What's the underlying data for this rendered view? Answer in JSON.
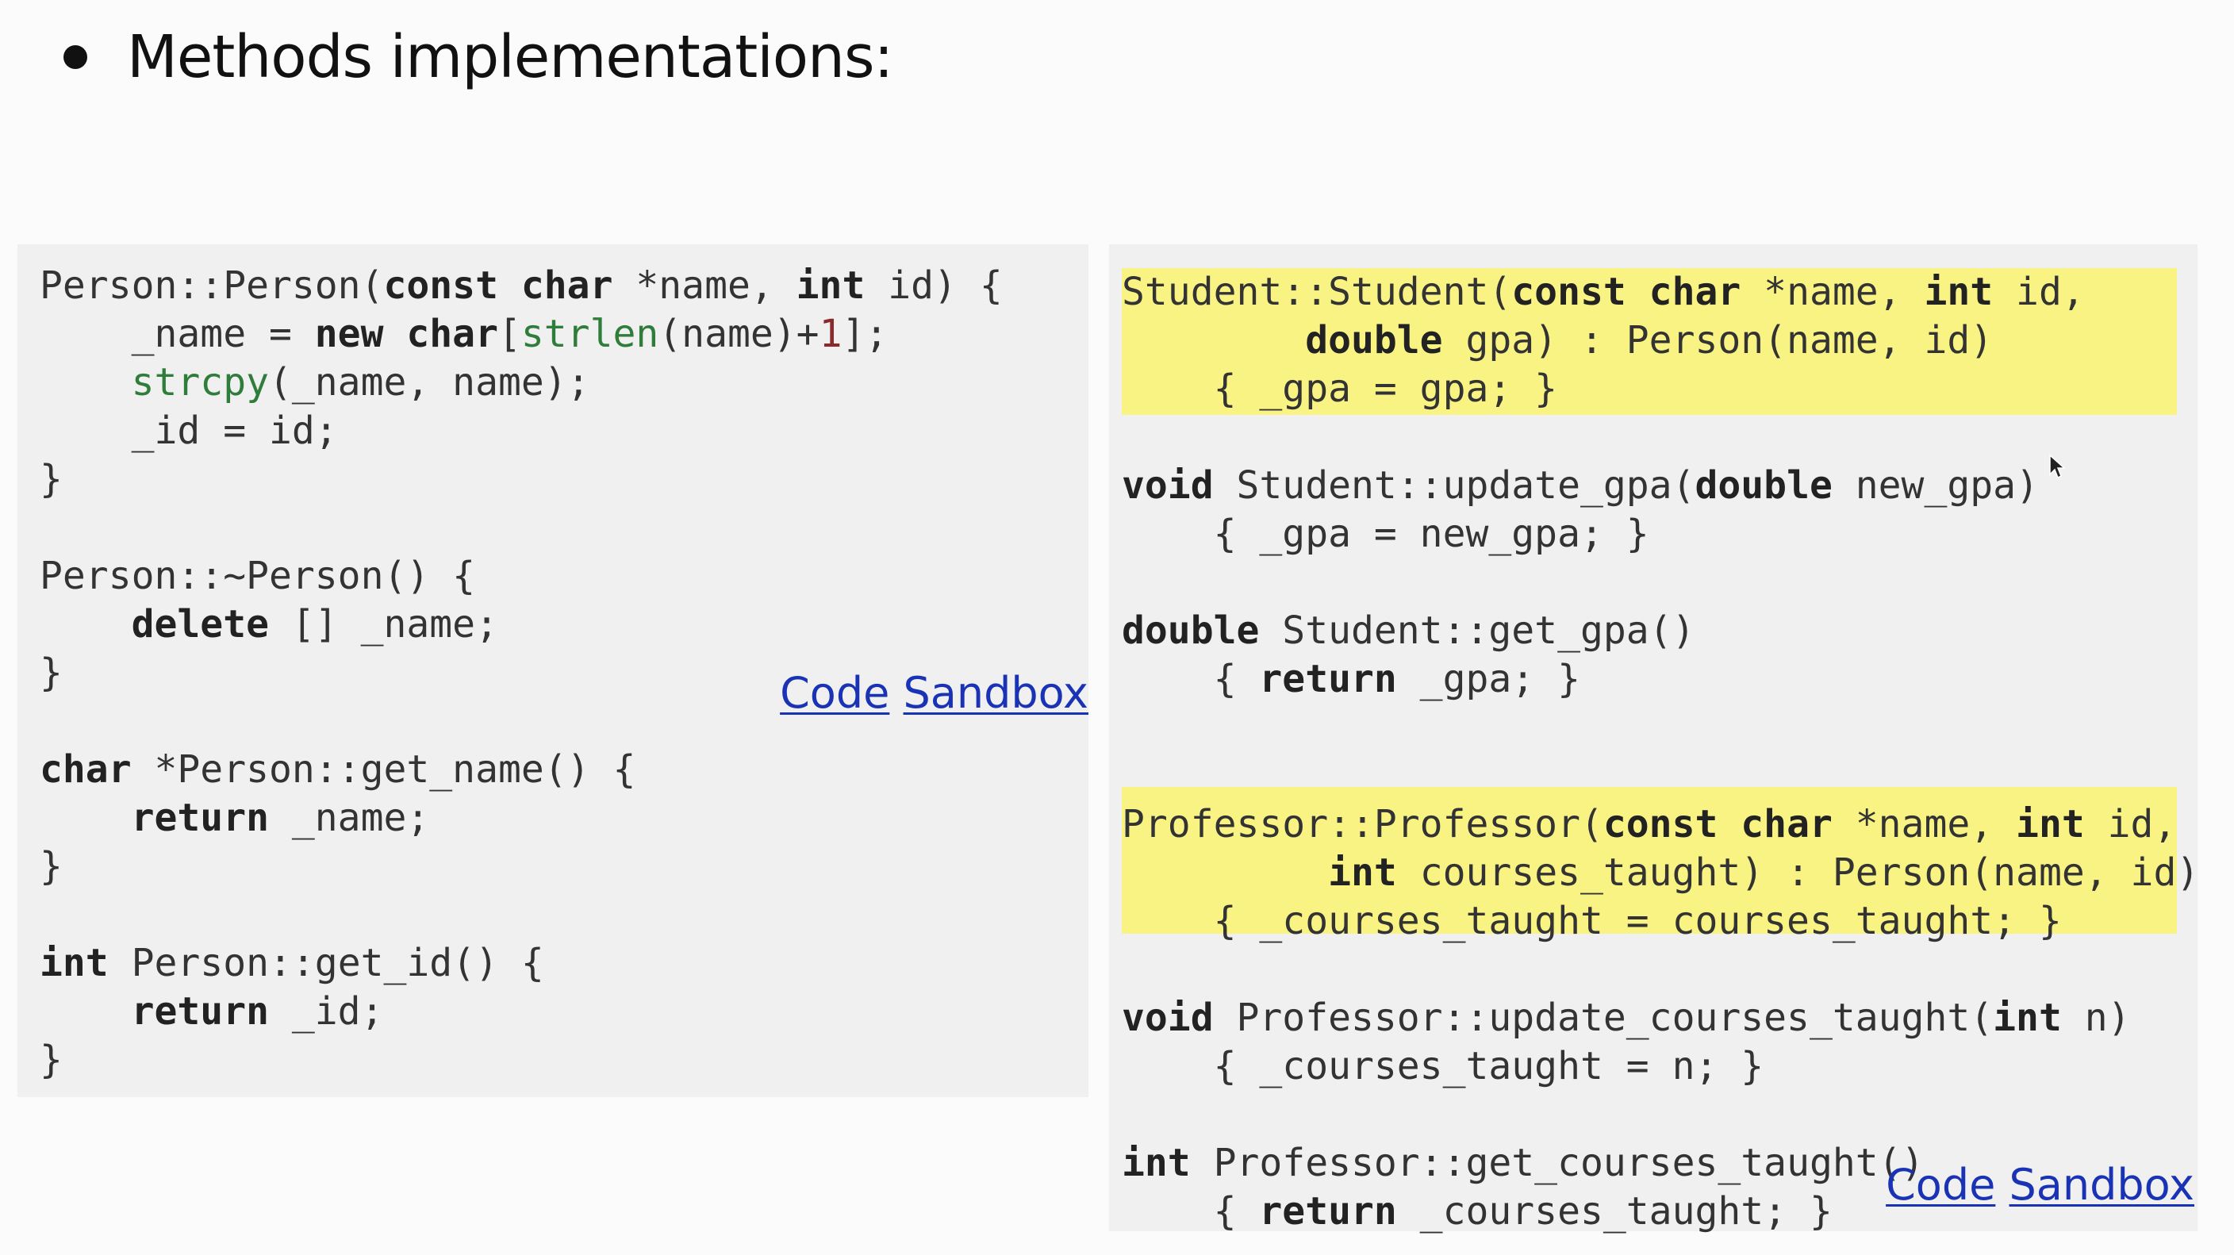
{
  "title": "Methods implementations:",
  "left_panel": {
    "code": [
      [
        {
          "t": "Person::Person("
        },
        {
          "t": "const char",
          "k": "kw"
        },
        {
          "t": " *name, "
        },
        {
          "t": "int",
          "k": "kw"
        },
        {
          "t": " id) {"
        }
      ],
      [
        {
          "t": "    _name = "
        },
        {
          "t": "new char",
          "k": "kw"
        },
        {
          "t": "["
        },
        {
          "t": "strlen",
          "k": "fn"
        },
        {
          "t": "(name)+"
        },
        {
          "t": "1",
          "k": "num"
        },
        {
          "t": "];"
        }
      ],
      [
        {
          "t": "    "
        },
        {
          "t": "strcpy",
          "k": "fn"
        },
        {
          "t": "(_name, name);"
        }
      ],
      [
        {
          "t": "    _id = id;"
        }
      ],
      [
        {
          "t": "}"
        }
      ],
      [
        {
          "t": ""
        }
      ],
      [
        {
          "t": "Person::~Person() {"
        }
      ],
      [
        {
          "t": "    "
        },
        {
          "t": "delete",
          "k": "kw"
        },
        {
          "t": " [] _name;"
        }
      ],
      [
        {
          "t": "}"
        }
      ],
      [
        {
          "t": ""
        }
      ],
      [
        {
          "t": "char",
          "k": "kw"
        },
        {
          "t": " *Person::get_name() {"
        }
      ],
      [
        {
          "t": "    "
        },
        {
          "t": "return",
          "k": "kw"
        },
        {
          "t": " _name;"
        }
      ],
      [
        {
          "t": "}"
        }
      ],
      [
        {
          "t": ""
        }
      ],
      [
        {
          "t": "int",
          "k": "kw"
        },
        {
          "t": " Person::get_id() {"
        }
      ],
      [
        {
          "t": "    "
        },
        {
          "t": "return",
          "k": "kw"
        },
        {
          "t": " _id;"
        }
      ],
      [
        {
          "t": "}"
        }
      ]
    ],
    "link_code": "Code",
    "link_sandbox": "Sandbox"
  },
  "right_panel": {
    "code": [
      [
        {
          "t": "Student::Student("
        },
        {
          "t": "const char",
          "k": "kw"
        },
        {
          "t": " *name, "
        },
        {
          "t": "int",
          "k": "kw"
        },
        {
          "t": " id,"
        }
      ],
      [
        {
          "t": "        "
        },
        {
          "t": "double",
          "k": "kw"
        },
        {
          "t": " gpa) : Person(name, id)"
        }
      ],
      [
        {
          "t": "    { _gpa = gpa; }"
        }
      ],
      [
        {
          "t": ""
        }
      ],
      [
        {
          "t": "void",
          "k": "kw"
        },
        {
          "t": " Student::update_gpa("
        },
        {
          "t": "double",
          "k": "kw"
        },
        {
          "t": " new_gpa)"
        }
      ],
      [
        {
          "t": "    { _gpa = new_gpa; }"
        }
      ],
      [
        {
          "t": ""
        }
      ],
      [
        {
          "t": "double",
          "k": "kw"
        },
        {
          "t": " Student::get_gpa()"
        }
      ],
      [
        {
          "t": "    { "
        },
        {
          "t": "return",
          "k": "kw"
        },
        {
          "t": " _gpa; }"
        }
      ],
      [
        {
          "t": ""
        }
      ],
      [
        {
          "t": ""
        }
      ],
      [
        {
          "t": "Professor::Professor("
        },
        {
          "t": "const char",
          "k": "kw"
        },
        {
          "t": " *name, "
        },
        {
          "t": "int",
          "k": "kw"
        },
        {
          "t": " id,"
        }
      ],
      [
        {
          "t": "         "
        },
        {
          "t": "int",
          "k": "kw"
        },
        {
          "t": " courses_taught) : Person(name, id)"
        }
      ],
      [
        {
          "t": "    { _courses_taught = courses_taught; }"
        }
      ],
      [
        {
          "t": ""
        }
      ],
      [
        {
          "t": "void",
          "k": "kw"
        },
        {
          "t": " Professor::update_courses_taught("
        },
        {
          "t": "int",
          "k": "kw"
        },
        {
          "t": " n)"
        }
      ],
      [
        {
          "t": "    { _courses_taught = n; }"
        }
      ],
      [
        {
          "t": ""
        }
      ],
      [
        {
          "t": "int",
          "k": "kw"
        },
        {
          "t": " Professor::get_courses_taught()"
        }
      ],
      [
        {
          "t": "    { "
        },
        {
          "t": "return",
          "k": "kw"
        },
        {
          "t": " _courses_taught; }"
        }
      ]
    ],
    "link_code": "Code",
    "link_sandbox": "Sandbox"
  },
  "colors": {
    "panel_background": "#f0f0f0",
    "highlight": "#f9f384",
    "link": "#1a33b5",
    "function_name": "#2f7d3a",
    "number_literal": "#8a2a2a"
  }
}
